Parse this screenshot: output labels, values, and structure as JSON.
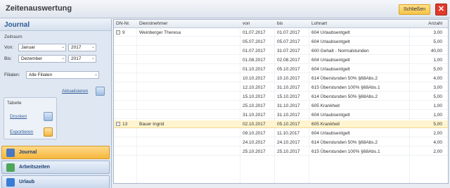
{
  "window": {
    "title": "Zeitenauswertung",
    "close_label": "Schließen"
  },
  "sidebar": {
    "title": "Journal",
    "zeitraum_label": "Zeitraum",
    "von_label": "Von:",
    "von_month": "Januar",
    "von_year": "2017",
    "bis_label": "Bis:",
    "bis_month": "Dezember",
    "bis_year": "2017",
    "filialen_label": "Filialen:",
    "filialen_value": "Alle Filialen",
    "refresh_label": "Aktualisieren",
    "tabelle_label": "Tabelle",
    "print_label": "Drucken",
    "export_label": "Exportieren",
    "nav": [
      {
        "label": "Journal",
        "icon": "journal-icon"
      },
      {
        "label": "Arbeitszeiten",
        "icon": "worktime-icon"
      },
      {
        "label": "Urlaub",
        "icon": "vacation-icon"
      }
    ]
  },
  "grid": {
    "columns": [
      "DN-Nr.",
      "Dienstnehmer",
      "von",
      "bis",
      "Lohnart",
      "Anzahl"
    ],
    "rows": [
      {
        "dn": "9",
        "name": "Weinberger Theresa",
        "von": "01.07.2017",
        "bis": "01.07.2017",
        "lohnart": "604 Urlaubsentgelt",
        "anzahl": "3,00",
        "group": true
      },
      {
        "dn": "",
        "name": "",
        "von": "05.07.2017",
        "bis": "05.07.2017",
        "lohnart": "604 Urlaubsentgelt",
        "anzahl": "5,00"
      },
      {
        "dn": "",
        "name": "",
        "von": "01.07.2017",
        "bis": "31.07.2017",
        "lohnart": "600 Gehalt - Normalstunden",
        "anzahl": "40,00"
      },
      {
        "dn": "",
        "name": "",
        "von": "01.08.2017",
        "bis": "02.08.2017",
        "lohnart": "604 Urlaubsentgelt",
        "anzahl": "1,00"
      },
      {
        "dn": "",
        "name": "",
        "von": "01.10.2017",
        "bis": "05.10.2017",
        "lohnart": "604 Urlaubsentgelt",
        "anzahl": "5,00"
      },
      {
        "dn": "",
        "name": "",
        "von": "10.10.2017",
        "bis": "10.10.2017",
        "lohnart": "614 Überstunden 50% §68Abs.2",
        "anzahl": "4,00"
      },
      {
        "dn": "",
        "name": "",
        "von": "12.10.2017",
        "bis": "31.10.2017",
        "lohnart": "615 Überstunden 100% §68Abs.1",
        "anzahl": "3,00"
      },
      {
        "dn": "",
        "name": "",
        "von": "15.10.2017",
        "bis": "15.10.2017",
        "lohnart": "614 Überstunden 50% §68Abs.2",
        "anzahl": "5,00"
      },
      {
        "dn": "",
        "name": "",
        "von": "25.10.2017",
        "bis": "31.10.2017",
        "lohnart": "605 Krankheit",
        "anzahl": "1,00"
      },
      {
        "dn": "",
        "name": "",
        "von": "31.10.2017",
        "bis": "31.10.2017",
        "lohnart": "604 Urlaubsentgelt",
        "anzahl": "1,00"
      },
      {
        "dn": "13",
        "name": "Bauer Ingrid",
        "von": "02.10.2017",
        "bis": "05.10.2017",
        "lohnart": "605 Krankheit",
        "anzahl": "5,00",
        "group": true,
        "selected": true
      },
      {
        "dn": "",
        "name": "",
        "von": "09.10.2017",
        "bis": "11.10.2017",
        "lohnart": "604 Urlaubsentgelt",
        "anzahl": "2,00"
      },
      {
        "dn": "",
        "name": "",
        "von": "24.10.2017",
        "bis": "24.10.2017",
        "lohnart": "614 Überstunden 50% §68Abs.2",
        "anzahl": "4,00"
      },
      {
        "dn": "",
        "name": "",
        "von": "25.10.2017",
        "bis": "25.10.2017",
        "lohnart": "615 Überstunden 100% §68Abs.1",
        "anzahl": "2,00"
      }
    ]
  },
  "colors": {
    "accent": "#2e5a97",
    "selection": "#fff4cf",
    "active_nav": "#f6b73c",
    "close": "#e03a2c"
  }
}
